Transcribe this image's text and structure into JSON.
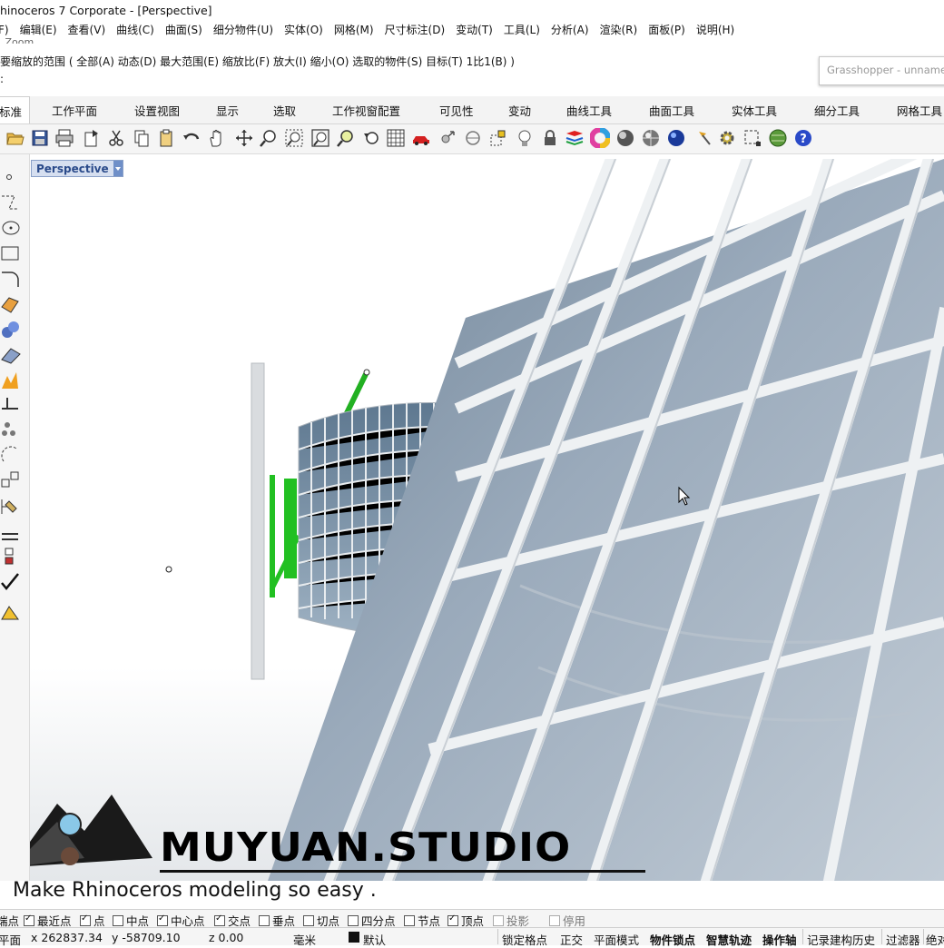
{
  "window": {
    "title": "hinoceros 7 Corporate - [Perspective]"
  },
  "menu": [
    "F)",
    "编辑(E)",
    "查看(V)",
    "曲线(C)",
    "曲面(S)",
    "细分物件(U)",
    "实体(O)",
    "网格(M)",
    "尺寸标注(D)",
    "变动(T)",
    "工具(L)",
    "分析(A)",
    "渲染(R)",
    "面板(P)",
    "说明(H)"
  ],
  "command": {
    "history": "_Zoom",
    "prompt": "要缩放的范围 ( 全部(A)  动态(D)  最大范围(E)  缩放比(F)  放大(I)  缩小(O)  选取的物件(S)  目标(T)  1比1(B) )",
    "input": ":"
  },
  "grasshopper": {
    "title": "Grasshopper - unnamed"
  },
  "tabs": [
    "标准",
    "工作平面",
    "设置视图",
    "显示",
    "选取",
    "工作视窗配置",
    "可见性",
    "变动",
    "曲线工具",
    "曲面工具",
    "实体工具",
    "细分工具",
    "网格工具"
  ],
  "viewport": {
    "label": "Perspective"
  },
  "watermark": {
    "brand": "MUYUAN.STUDIO",
    "tagline": "Make Rhinoceros modeling so easy ."
  },
  "osnap": [
    {
      "label": "端点",
      "checked": true
    },
    {
      "label": "最近点",
      "checked": true
    },
    {
      "label": "点",
      "checked": true
    },
    {
      "label": "中点",
      "checked": false
    },
    {
      "label": "中心点",
      "checked": true
    },
    {
      "label": "交点",
      "checked": true
    },
    {
      "label": "垂点",
      "checked": false
    },
    {
      "label": "切点",
      "checked": false
    },
    {
      "label": "四分点",
      "checked": false
    },
    {
      "label": "节点",
      "checked": false
    },
    {
      "label": "顶点",
      "checked": true
    },
    {
      "label": "投影",
      "checked": false
    },
    {
      "label": "停用",
      "checked": false
    }
  ],
  "status": {
    "cplane": "平面",
    "x": "x 262837.34",
    "y": "y -58709.10",
    "z": "z 0.00",
    "units": "毫米",
    "layer": "默认",
    "grid_snap": "锁定格点",
    "ortho": "正交",
    "planar": "平面模式",
    "osnap": "物件锁点",
    "smarttrack": "智慧轨迹",
    "gumball": "操作轴",
    "history": "记录建构历史",
    "filter": "过滤器",
    "abs": "绝对"
  }
}
